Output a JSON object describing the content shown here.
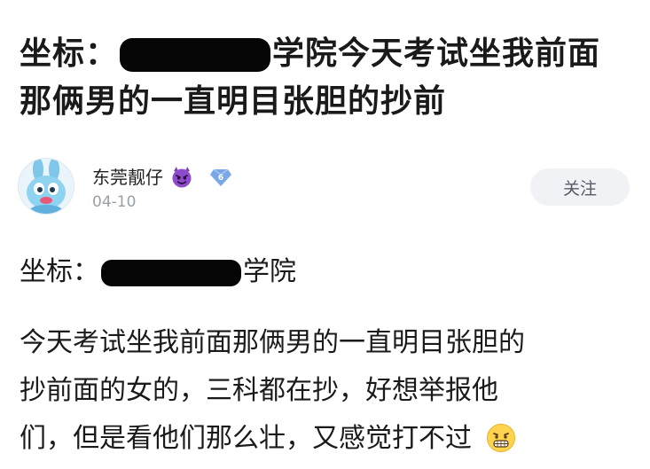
{
  "headline": {
    "prefix": "坐标：",
    "line1_suffix": "学院今天考试坐我前面",
    "line2": "那俩男的一直明目张胆的抄前"
  },
  "author": {
    "name": "东莞靓仔",
    "badge_level": "6",
    "date": "04-10",
    "name_emoji": "devil-icon",
    "badge_icon": "vip-diamond-icon"
  },
  "follow_button": {
    "label": "关注"
  },
  "post": {
    "location_prefix": "坐标：",
    "location_suffix": "学院",
    "body_line1": "今天考试坐我前面那俩男的一直明目张胆的",
    "body_line2": "抄前面的女的，三科都在抄，好想举报他",
    "body_line3": "们，但是看他们那么壮，又感觉打不过",
    "end_emoji": "grimace-icon"
  },
  "colors": {
    "text": "#1a1a1a",
    "date": "#9aa0a8",
    "follow_bg": "#f1f2f6",
    "badge": "#7aa8e6"
  }
}
